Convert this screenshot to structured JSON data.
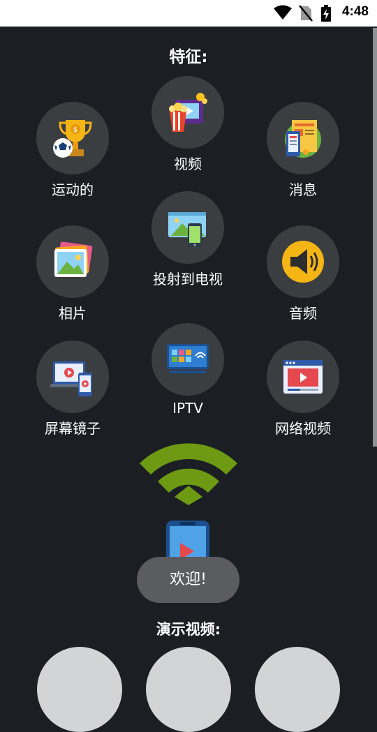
{
  "status_bar": {
    "time": "4:48",
    "icons": [
      "wifi-icon",
      "no-sim-icon",
      "battery-charging-icon"
    ]
  },
  "features_title": "特征:",
  "features": [
    {
      "id": "video",
      "label": "视频",
      "icon": "popcorn-film-icon"
    },
    {
      "id": "sport",
      "label": "运动的",
      "icon": "trophy-soccer-icon"
    },
    {
      "id": "news",
      "label": "消息",
      "icon": "newspaper-icon"
    },
    {
      "id": "cast",
      "label": "投射到电视",
      "icon": "screen-cast-icon"
    },
    {
      "id": "photos",
      "label": "相片",
      "icon": "photo-gallery-icon"
    },
    {
      "id": "audio",
      "label": "音频",
      "icon": "speaker-icon"
    },
    {
      "id": "iptv",
      "label": "IPTV",
      "icon": "smart-tv-icon"
    },
    {
      "id": "mirror",
      "label": "屏幕镜子",
      "icon": "screen-mirror-icon"
    },
    {
      "id": "web_video",
      "label": "网络视频",
      "icon": "web-video-player-icon"
    }
  ],
  "toast": "欢迎!",
  "demo_title": "演示视频:",
  "demo_count": 3,
  "colors": {
    "background": "#1b1f24",
    "circle": "#3b3e41",
    "wifi_green": "#6d9a12",
    "toast": "#5a5c5f"
  }
}
